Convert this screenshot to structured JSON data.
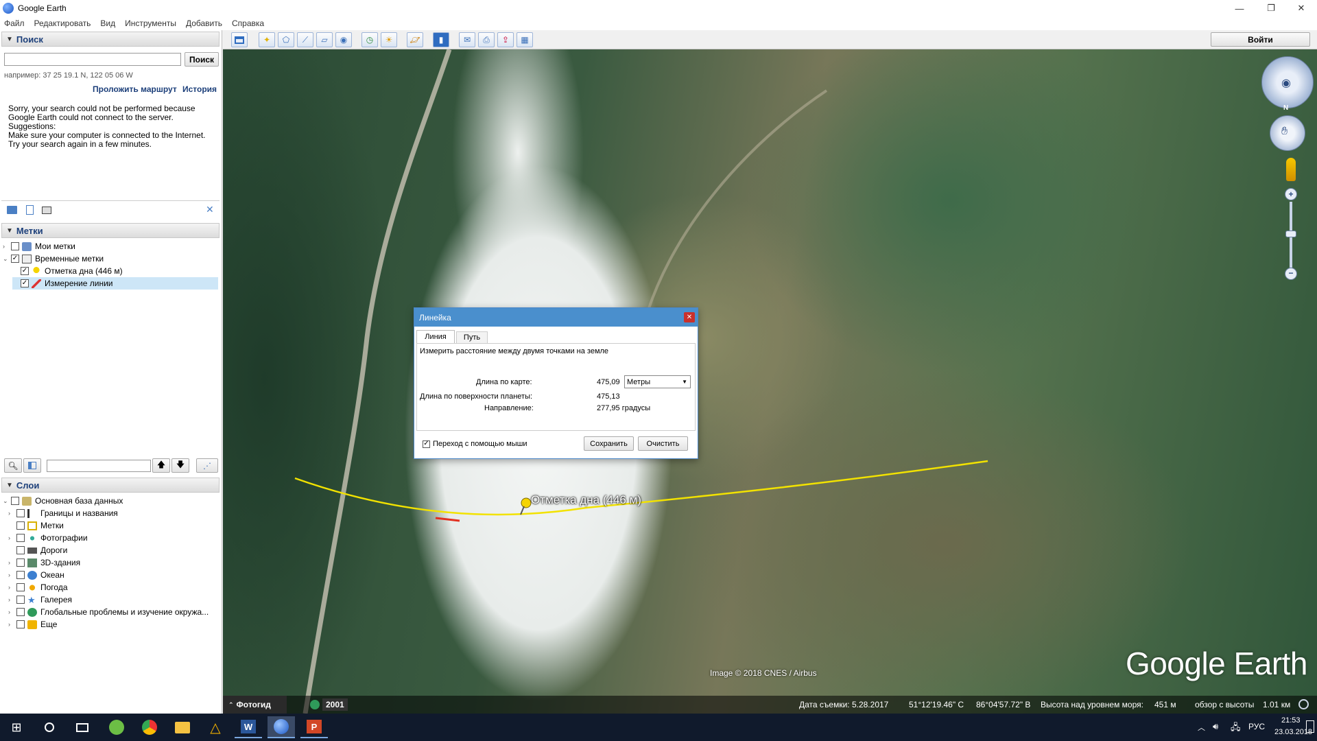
{
  "window": {
    "title": "Google Earth"
  },
  "menu": [
    "Файл",
    "Редактировать",
    "Вид",
    "Инструменты",
    "Добавить",
    "Справка"
  ],
  "search_panel": {
    "header": "Поиск",
    "input_value": "",
    "button": "Поиск",
    "example": "например: 37 25 19.1 N, 122 05 06 W",
    "route_link": "Проложить маршрут",
    "history_link": "История",
    "message": "Sorry, your search could not be performed because Google Earth could not connect to the server.\nSuggestions:\nMake sure your computer is connected to the Internet.\nTry your search again in a few minutes."
  },
  "places_panel": {
    "header": "Метки",
    "items": [
      {
        "label": "Мои метки",
        "checked": false,
        "level": 0
      },
      {
        "label": "Временные метки",
        "checked": true,
        "level": 0
      },
      {
        "label": "Отметка дна (446 м)",
        "checked": true,
        "level": 1
      },
      {
        "label": "Измерение линии",
        "checked": true,
        "level": 1,
        "selected": true
      }
    ]
  },
  "layers_panel": {
    "header": "Слои",
    "items": [
      {
        "label": "Основная база данных",
        "level": 0
      },
      {
        "label": "Границы и названия",
        "level": 1
      },
      {
        "label": "Метки",
        "level": 1
      },
      {
        "label": "Фотографии",
        "level": 1
      },
      {
        "label": "Дороги",
        "level": 1
      },
      {
        "label": "3D-здания",
        "level": 1
      },
      {
        "label": "Океан",
        "level": 1
      },
      {
        "label": "Погода",
        "level": 1
      },
      {
        "label": "Галерея",
        "level": 1
      },
      {
        "label": "Глобальные проблемы и изучение окружа...",
        "level": 1
      },
      {
        "label": "Еще",
        "level": 1
      }
    ]
  },
  "toolbar": {
    "signin": "Войти"
  },
  "ruler": {
    "title": "Линейка",
    "tabs": [
      "Линия",
      "Путь"
    ],
    "description": "Измерить расстояние между двумя точками на земле",
    "map_length_label": "Длина по карте:",
    "map_length_value": "475,09",
    "unit": "Метры",
    "ground_length_label": "Длина по поверхности планеты:",
    "ground_length_value": "475,13",
    "heading_label": "Направление:",
    "heading_value": "277,95 градусы",
    "mouse_nav": "Переход с помощью мыши",
    "save": "Сохранить",
    "clear": "Очистить"
  },
  "map": {
    "placemark_label": "Отметка дна (446 м)",
    "credit": "Image © 2018 CNES / Airbus",
    "watermark": "Google Earth",
    "tour_guide": "Фотогид",
    "year": "2001"
  },
  "status": {
    "date": "Дата съемки: 5.28.2017",
    "lat": "51°12'19.46\" С",
    "lon": "86°04'57.72\" В",
    "elev_label": "Высота над уровнем моря:",
    "elev": "451 м",
    "eye_label": "обзор с высоты",
    "eye": "1.01 км"
  },
  "taskbar": {
    "time": "21:53",
    "date": "23.03.2018",
    "lang": "РУС"
  }
}
